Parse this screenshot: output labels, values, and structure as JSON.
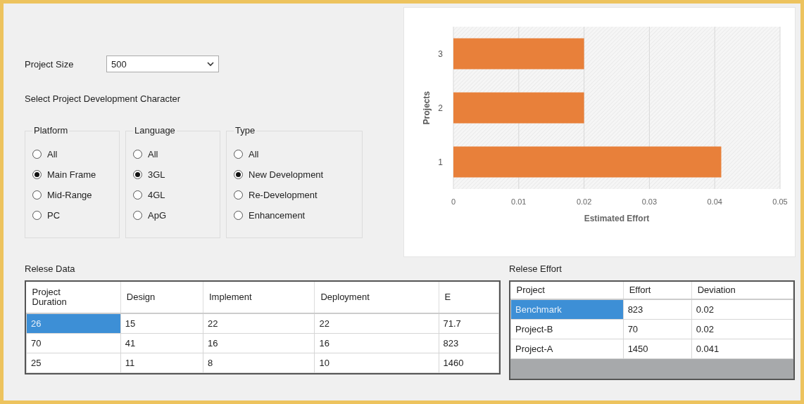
{
  "project_size": {
    "label": "Project Size",
    "value": "500"
  },
  "character_label": "Select Project Development Character",
  "groups": [
    {
      "title": "Platform",
      "options": [
        {
          "label": "All",
          "selected": false
        },
        {
          "label": "Main Frame",
          "selected": true
        },
        {
          "label": "Mid-Range",
          "selected": false
        },
        {
          "label": "PC",
          "selected": false
        }
      ]
    },
    {
      "title": "Language",
      "options": [
        {
          "label": "All",
          "selected": false
        },
        {
          "label": "3GL",
          "selected": true
        },
        {
          "label": "4GL",
          "selected": false
        },
        {
          "label": "ApG",
          "selected": false
        }
      ]
    },
    {
      "title": "Type",
      "options": [
        {
          "label": "All",
          "selected": false
        },
        {
          "label": "New Development",
          "selected": true
        },
        {
          "label": "Re-Development",
          "selected": false
        },
        {
          "label": "Enhancement",
          "selected": false
        }
      ]
    }
  ],
  "chart": {
    "chart_data": {
      "type": "bar",
      "orientation": "horizontal",
      "xlabel": "Estimated Effort",
      "ylabel": "Projects",
      "categories": [
        "3",
        "2",
        "1"
      ],
      "grid": true,
      "series": [
        {
          "color": "#e8803a",
          "values": [
            0.02,
            0.02,
            0.041
          ]
        }
      ],
      "xlim": [
        0,
        0.05
      ],
      "xticks": [
        0,
        0.01,
        0.02,
        0.03,
        0.04,
        0.05
      ]
    }
  },
  "release_data": {
    "title": "Relese Data",
    "columns": [
      "Project\nDuration",
      "Design",
      "Implement",
      "Deployment",
      "E"
    ],
    "rows": [
      {
        "selected": true,
        "cells": [
          "26",
          "15",
          "22",
          "22",
          "71.7"
        ]
      },
      {
        "selected": false,
        "cells": [
          "70",
          "41",
          "16",
          "16",
          "823"
        ]
      },
      {
        "selected": false,
        "cells": [
          "25",
          "11",
          "8",
          "10",
          "1460"
        ]
      }
    ]
  },
  "release_effort": {
    "title": "Relese Effort",
    "columns": [
      "Project",
      "Effort",
      "Deviation"
    ],
    "rows": [
      {
        "selected": true,
        "cells": [
          "Benchmark",
          "823",
          "0.02"
        ]
      },
      {
        "selected": false,
        "cells": [
          "Project-B",
          "70",
          "0.02"
        ]
      },
      {
        "selected": false,
        "cells": [
          "Project-A",
          "1450",
          "0.041"
        ]
      }
    ]
  }
}
